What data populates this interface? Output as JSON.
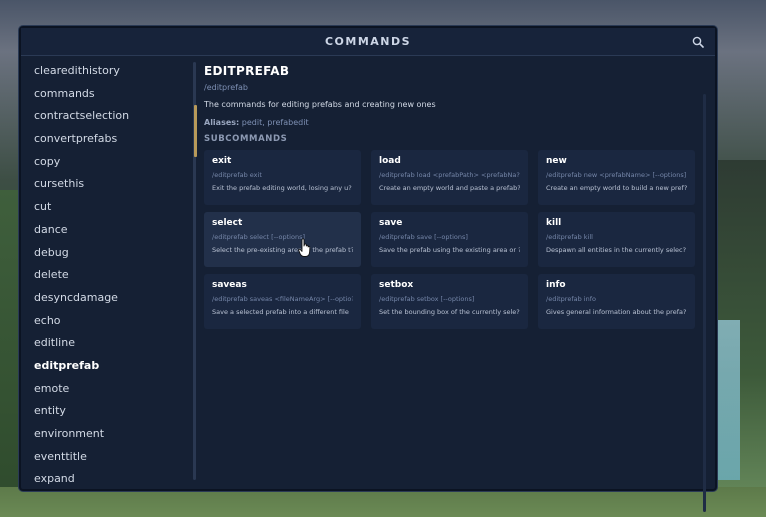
{
  "window": {
    "title": "COMMANDS",
    "search_icon": "search-icon"
  },
  "sidebar": {
    "items": [
      "clearedithistory",
      "commands",
      "contractselection",
      "convertprefabs",
      "copy",
      "cursethis",
      "cut",
      "dance",
      "debug",
      "delete",
      "desyncdamage",
      "echo",
      "editline",
      "editprefab",
      "emote",
      "entity",
      "environment",
      "eventtitle",
      "expand"
    ],
    "active": "editprefab"
  },
  "detail": {
    "title": "EDITPREFAB",
    "path": "/editprefab",
    "description": "The commands for editing prefabs and creating new ones",
    "aliases_label": "Aliases:",
    "aliases": "pedit, prefabedit",
    "subcommands_heading": "SUBCOMMANDS",
    "accent_color": "#b89a5a"
  },
  "subcommands": [
    {
      "name": "exit",
      "usage": "/editprefab exit",
      "desc": "Exit the prefab editing world, losing any u?"
    },
    {
      "name": "load",
      "usage": "/editprefab load <prefabPath> <prefabNa?>??",
      "desc": "Create an empty world and paste a prefab?"
    },
    {
      "name": "new",
      "usage": "/editprefab new <prefabName> [--options]",
      "desc": "Create an empty world to build a new pref?"
    },
    {
      "name": "select",
      "usage": "/editprefab select [--options]",
      "desc": "Select the pre-existing area of the prefab t?"
    },
    {
      "name": "save",
      "usage": "/editprefab save [--options]",
      "desc": "Save the prefab using the existing area or ?"
    },
    {
      "name": "kill",
      "usage": "/editprefab kill",
      "desc": "Despawn all entities in the currently selec?"
    },
    {
      "name": "saveas",
      "usage": "/editprefab saveas <fileNameArg> [--optio?]",
      "desc": "Save a selected prefab into a different file"
    },
    {
      "name": "setbox",
      "usage": "/editprefab setbox [--options]",
      "desc": "Set the bounding box of the currently sele?"
    },
    {
      "name": "info",
      "usage": "/editprefab info",
      "desc": "Gives general information about the prefa?"
    }
  ]
}
